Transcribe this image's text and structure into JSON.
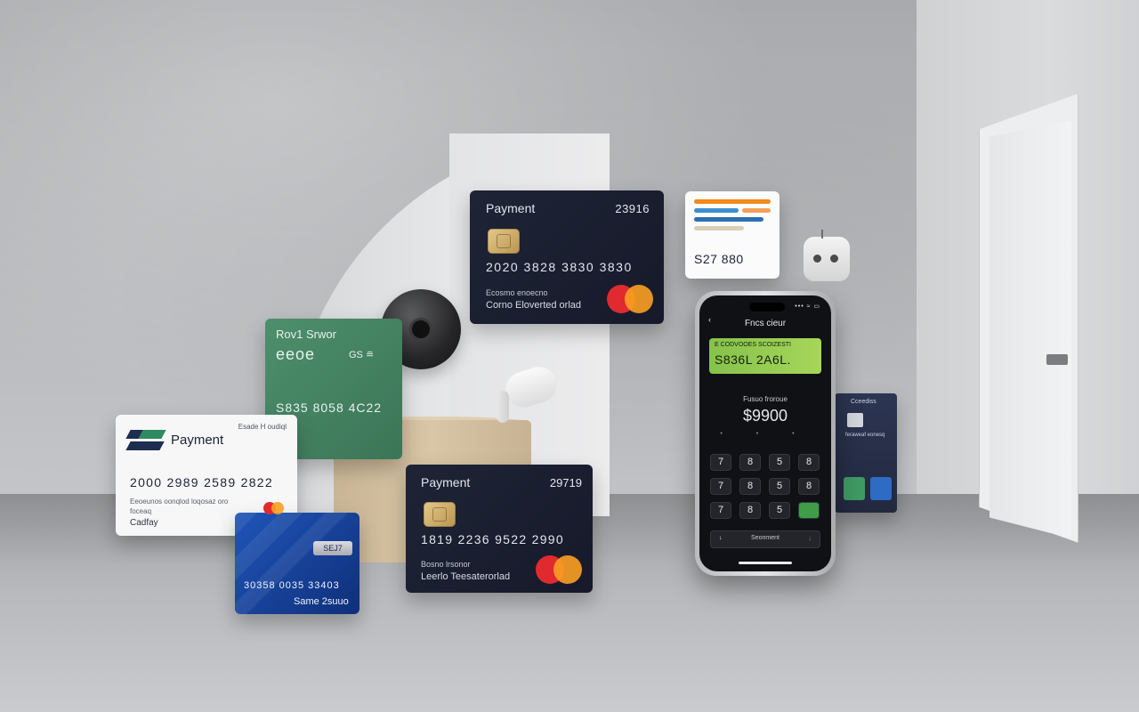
{
  "card_top": {
    "title": "Payment",
    "number_right": "23916",
    "card_number": "2020 3828 3830 3830",
    "line1": "Ecosmo enoecno",
    "line2": "Corno Eloverted orlad"
  },
  "card_bottom": {
    "title": "Payment",
    "number_right": "29719",
    "card_number": "1819 2236 9522 2990",
    "line1": "Bosno lrsonor",
    "line2": "Leerlo Teesaterorlad"
  },
  "card_green": {
    "title": "Rov1 Srwor",
    "glyphs": "eeoe",
    "mark": "GS ≘",
    "card_number": "S835 8058 4C22"
  },
  "card_white": {
    "title": "Payment",
    "top_right": "Esade  H oudiql",
    "card_number": "2000 2989 2589 2822",
    "line1": "Eeoeunos oonqlod loqosaz oro",
    "line2": "foceaq",
    "line3": "Cadfay"
  },
  "card_blue": {
    "badge": "SEJ7",
    "card_number": "30358 0035 33403",
    "name": "Same 2suuo"
  },
  "receipt": {
    "amount": "S27 880"
  },
  "side_card": {
    "title": "Cceediss",
    "label": "feraweaf eonesq"
  },
  "phone": {
    "status": "••• ≈ ▭",
    "back": "‹",
    "title": "Fncs cieur",
    "banner_title": "E CODVOOES SCOIZESTI",
    "banner_value": "S836L   2A6L.",
    "label": "Fusuo froroue",
    "amount": "$9900",
    "dots": "• • •",
    "keys": [
      "7",
      "8",
      "5",
      "8",
      "7",
      "8",
      "5",
      "8",
      "7",
      "8",
      "5",
      ""
    ],
    "bar_left": "↓",
    "bar_center": "Seonment",
    "bar_right": "↓"
  },
  "colors": {
    "card_dark": "#1e2436",
    "card_green": "#4d8f6c",
    "card_blue": "#1f55b8",
    "phone_banner": "#9acd50",
    "mastercard_red": "#e02a2f",
    "mastercard_orange": "#f9a022"
  }
}
